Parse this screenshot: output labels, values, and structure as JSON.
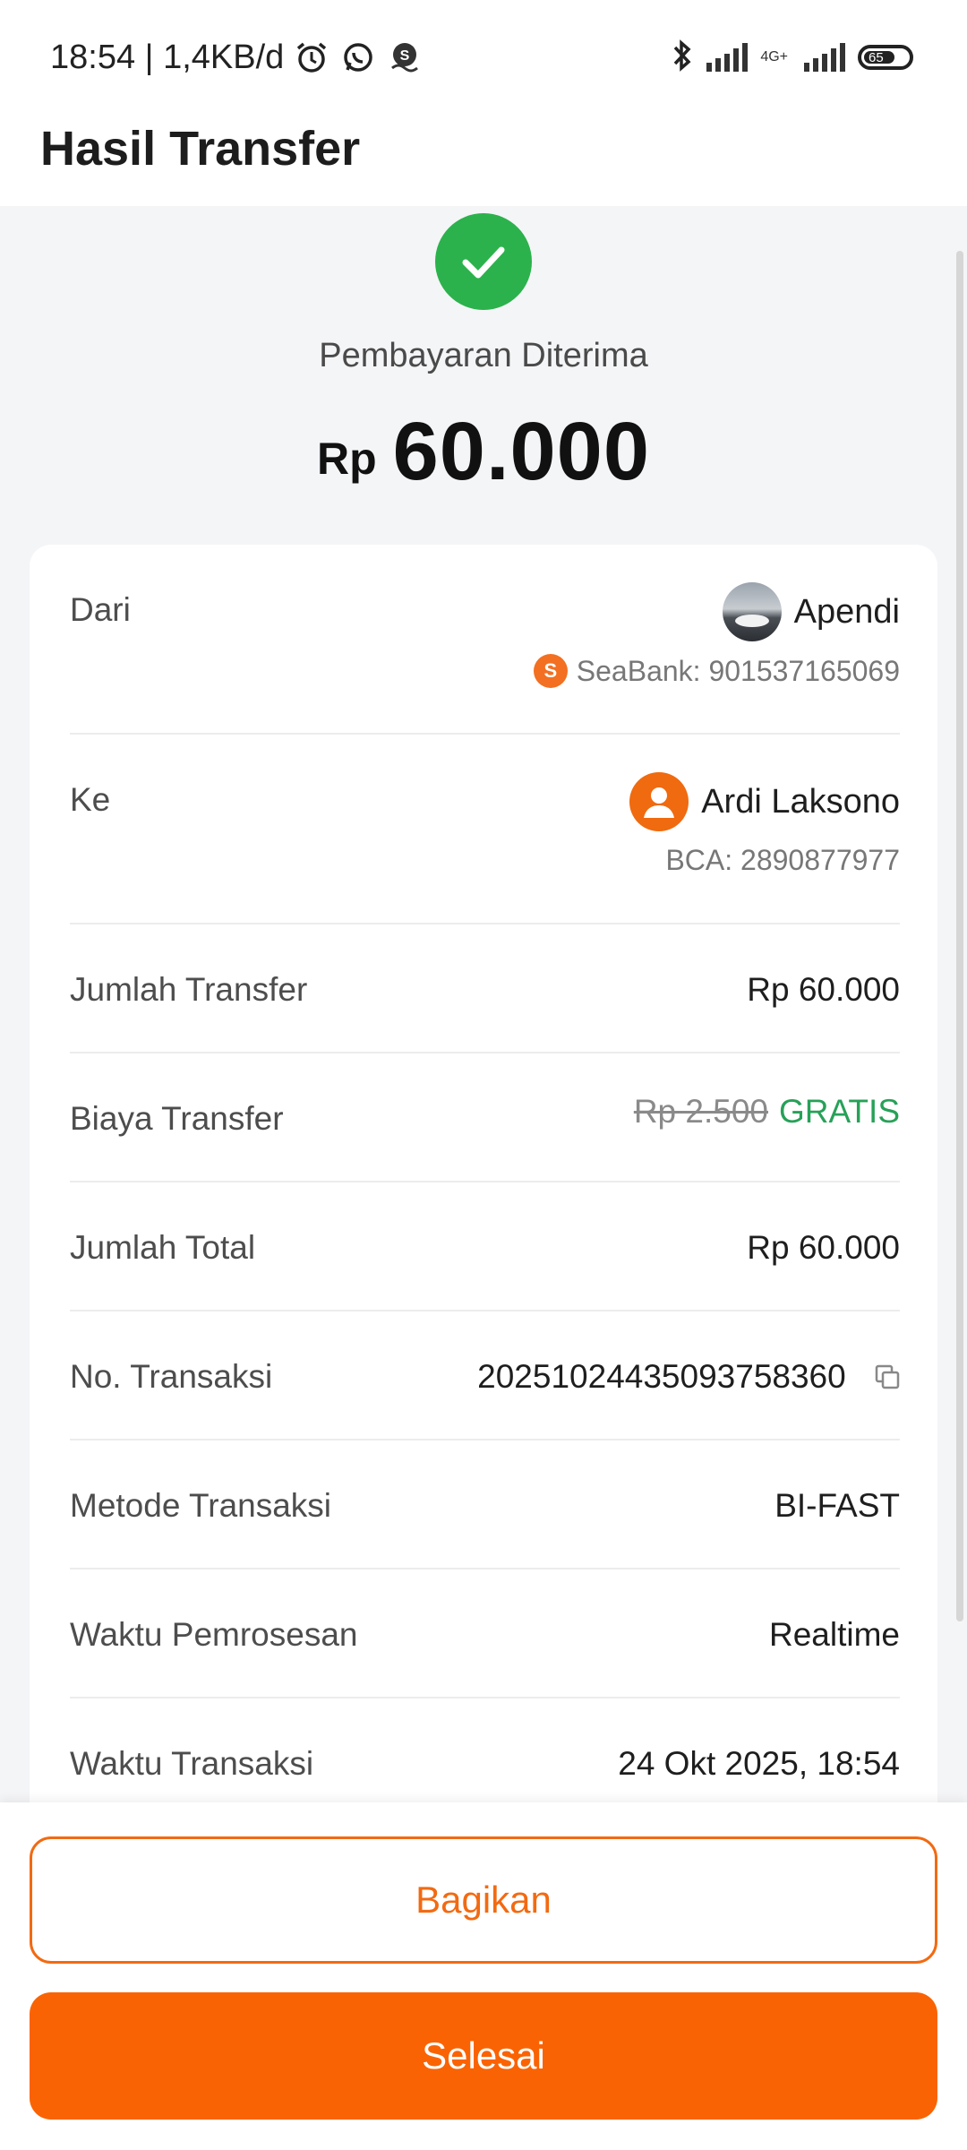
{
  "status_bar": {
    "time_info": "18:54 | 1,4KB/d",
    "network_label": "4G+",
    "battery_level": "65",
    "icons": [
      "alarm-icon",
      "whatsapp-icon",
      "seabank-icon",
      "bluetooth-icon",
      "signal-icon",
      "signal-icon-2",
      "battery-icon"
    ]
  },
  "header": {
    "title": "Hasil Transfer"
  },
  "summary": {
    "status": "Pembayaran Diterima",
    "currency": "Rp",
    "amount": "60.000",
    "status_color": "#2bb24c"
  },
  "details": {
    "from": {
      "label": "Dari",
      "name": "Apendi",
      "account": "SeaBank: 901537165069"
    },
    "to": {
      "label": "Ke",
      "name": "Ardi Laksono",
      "account": "BCA: 2890877977"
    },
    "rows": [
      {
        "label": "Jumlah Transfer",
        "value": "Rp 60.000"
      },
      {
        "label": "Biaya Transfer",
        "original_value": "Rp 2.500",
        "value": "GRATIS"
      },
      {
        "label": "Jumlah Total",
        "value": "Rp 60.000"
      },
      {
        "label": "No. Transaksi",
        "value": "20251024435093758360"
      },
      {
        "label": "Metode Transaksi",
        "value": "BI-FAST"
      },
      {
        "label": "Waktu Pemrosesan",
        "value": "Realtime"
      },
      {
        "label": "Waktu Transaksi",
        "value": "24 Okt 2025, 18:54"
      }
    ]
  },
  "actions": {
    "share_label": "Bagikan",
    "done_label": "Selesai",
    "accent_color": "#fa6303"
  }
}
